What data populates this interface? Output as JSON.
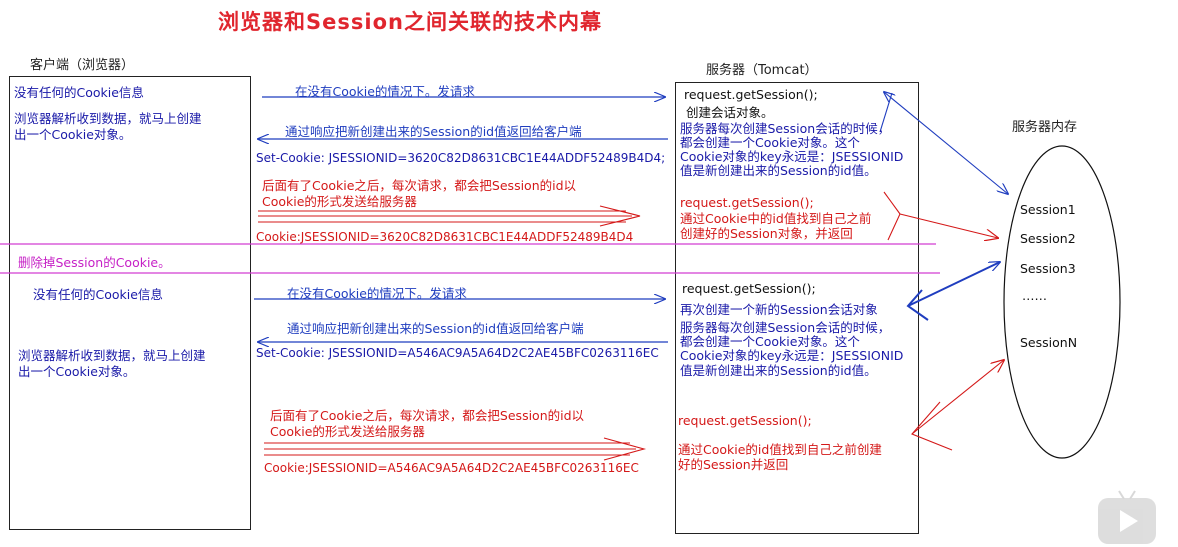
{
  "title": "浏览器和Session之间关联的技术内幕",
  "client_header": "客户端（浏览器）",
  "server_header": "服务器（Tomcat）",
  "memory_header": "服务器内存",
  "client": {
    "no_cookie_1": "没有任何的Cookie信息",
    "parse_1_line1": "浏览器解析收到数据，就马上创建",
    "parse_1_line2": "出一个Cookie对象。",
    "no_cookie_2": "没有任何的Cookie信息",
    "parse_2_line1": "浏览器解析收到数据，就马上创建",
    "parse_2_line2": "出一个Cookie对象。"
  },
  "arrows": {
    "req_no_cookie_1": "在没有Cookie的情况下。发请求",
    "resp_1": "通过响应把新创建出来的Session的id值返回给客户端",
    "set_cookie_1": "Set-Cookie:  JSESSIONID=3620C82D8631CBC1E44ADDF52489B4D4;",
    "after_1_line1": "后面有了Cookie之后，每次请求，都会把Session的id以",
    "after_1_line2": "Cookie的形式发送给服务器",
    "cookie_1": "Cookie:JSESSIONID=3620C82D8631CBC1E44ADDF52489B4D4",
    "delete_cookie": "删除掉Session的Cookie。",
    "req_no_cookie_2": "在没有Cookie的情况下。发请求",
    "resp_2": "通过响应把新创建出来的Session的id值返回给客户端",
    "set_cookie_2": "Set-Cookie:  JSESSIONID=A546AC9A5A64D2C2AE45BFC0263116EC",
    "after_2_line1": "后面有了Cookie之后，每次请求，都会把Session的id以",
    "after_2_line2": "Cookie的形式发送给服务器",
    "cookie_2": "Cookie:JSESSIONID=A546AC9A5A64D2C2AE45BFC0263116EC"
  },
  "server": {
    "get_session_1": "request.getSession();",
    "create_obj": "创建会话对象。",
    "explain_1_l1": "服务器每次创建Session会话的时候，",
    "explain_1_l2": "都会创建一个Cookie对象。这个",
    "explain_1_l3": "Cookie对象的key永远是：JSESSIONID",
    "explain_1_l4": "值是新创建出来的Session的id值。",
    "get_session_2": "request.getSession();",
    "find_1_l1": "通过Cookie中的id值找到自己之前",
    "find_1_l2": "创建好的Session对象，并返回",
    "get_session_3": "request.getSession();",
    "recreate": "再次创建一个新的Session会话对象",
    "explain_2_l1": "服务器每次创建Session会话的时候，",
    "explain_2_l2": "都会创建一个Cookie对象。这个",
    "explain_2_l3": "Cookie对象的key永远是：JSESSIONID",
    "explain_2_l4": "值是新创建出来的Session的id值。",
    "get_session_4": "request.getSession();",
    "find_2_l1": "通过Cookie的id值找到自己之前创建",
    "find_2_l2": "好的Session并返回"
  },
  "memory": {
    "items": [
      "Session1",
      "Session2",
      "Session3",
      "……",
      "SessionN"
    ]
  },
  "colors": {
    "title": "#e0262e",
    "blue_arrow": "#1f3dbf",
    "red_arrow": "#d41818",
    "divider": "#d23fd2"
  }
}
